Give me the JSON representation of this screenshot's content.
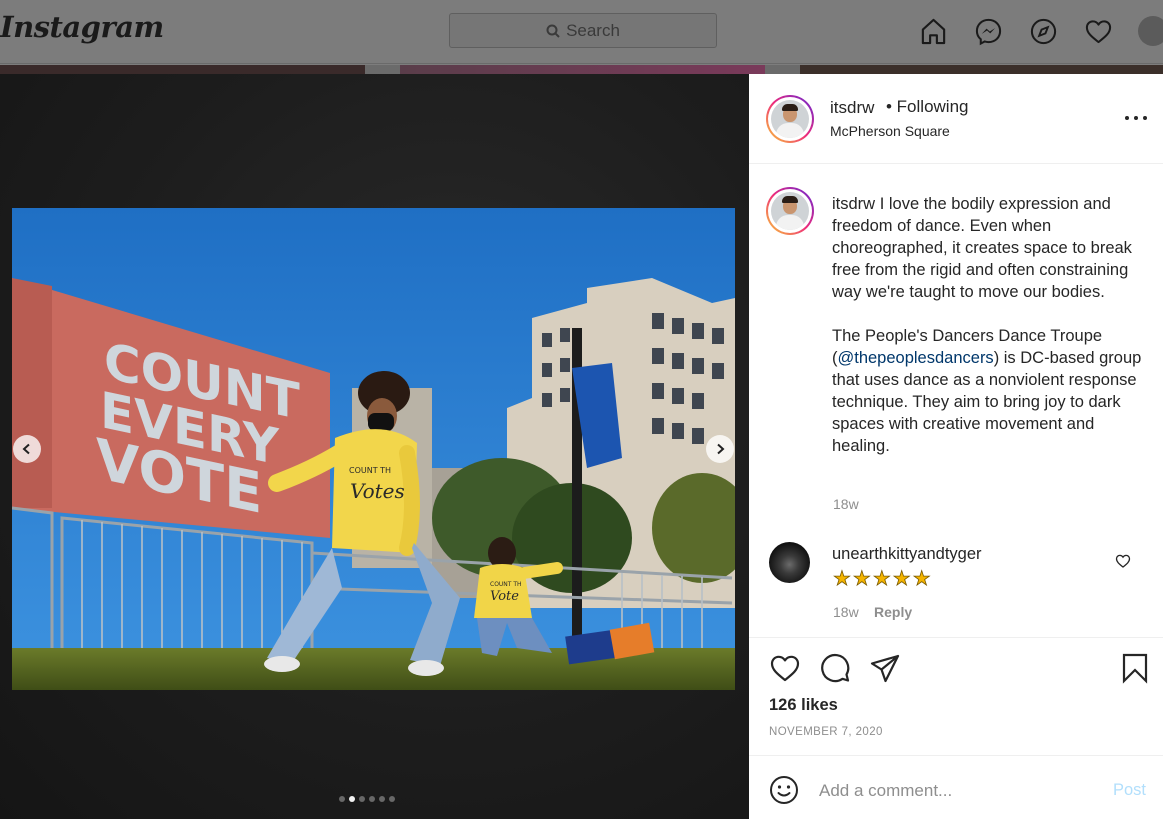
{
  "app": {
    "logo": "Instagram"
  },
  "search": {
    "placeholder": "Search"
  },
  "nav": [
    "home-icon",
    "messenger-icon",
    "explore-icon",
    "activity-heart-icon",
    "profile-avatar"
  ],
  "post": {
    "username": "itsdrw",
    "follow_status": "• Following",
    "location": "McPherson Square",
    "caption_user": "itsdrw",
    "caption_p1": "I love the bodily expression and freedom of dance. Even when choreographed, it creates space to break free from the rigid and often constraining way we're taught to move our bodies.",
    "caption_p2_before": "The People's Dancers Dance Troupe (",
    "caption_mention": "@thepeoplesdancers",
    "caption_p2_after": ") is DC-based group that uses dance as a nonviolent response technique. They aim to bring joy to dark spaces with creative movement and healing.",
    "caption_age": "18w",
    "likes": "126 likes",
    "date": "NOVEMBER 7, 2020",
    "carousel": {
      "count": 6,
      "active_index": 1
    },
    "photo_text": {
      "sign_line1": "COUNT",
      "sign_line2": "EVERY",
      "sign_line3": "VOTE",
      "hoodie1_small": "COUNT TH",
      "hoodie1_big": "Votes",
      "hoodie2_small": "COUNT TH",
      "hoodie2_big": "Vote"
    }
  },
  "comments": [
    {
      "username": "unearthkittyandtyger",
      "text": "★★★★★",
      "age": "18w",
      "reply_label": "Reply"
    }
  ],
  "add_comment": {
    "placeholder": "Add a comment...",
    "post_label": "Post"
  },
  "colors": {
    "link": "#00376b",
    "post_disabled": "#b2dffc",
    "meta": "#8e8e8e",
    "star": "#f4b400"
  }
}
